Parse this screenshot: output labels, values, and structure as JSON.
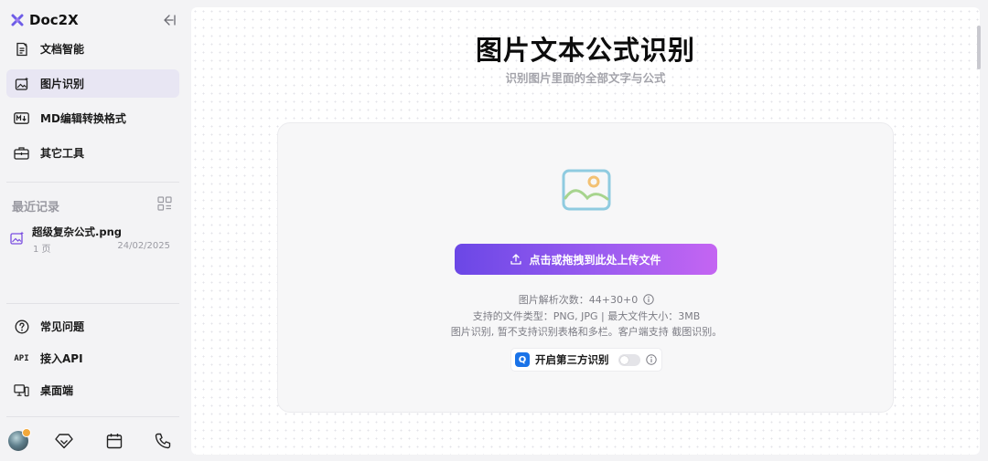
{
  "brand": {
    "name": "Doc2X"
  },
  "sidebar": {
    "nav": [
      {
        "label": "文档智能",
        "icon": "document-ai-icon",
        "active": false
      },
      {
        "label": "图片识别",
        "icon": "image-recognition-icon",
        "active": true
      },
      {
        "label": "MD编辑转换格式",
        "icon": "markdown-icon",
        "active": false
      },
      {
        "label": "其它工具",
        "icon": "toolbox-icon",
        "active": false
      }
    ],
    "recent": {
      "title": "最近记录",
      "items": [
        {
          "name": "超级复杂公式.png",
          "pages": "1 页",
          "date": "24/02/2025"
        }
      ]
    },
    "bottom_nav": [
      {
        "label": "常见问题",
        "icon": "help-icon"
      },
      {
        "label": "接入API",
        "icon": "api-icon",
        "glyph": "API"
      },
      {
        "label": "桌面端",
        "icon": "desktop-icon"
      }
    ]
  },
  "main": {
    "title": "图片文本公式识别",
    "subtitle": "识别图片里面的全部文字与公式",
    "upload_button": "点击或拖拽到此处上传文件",
    "parse_count_label": "图片解析次数：44+30+0",
    "file_types": "支持的文件类型：PNG, JPG  |  最大文件大小：3MB",
    "notice": "图片识别, 暂不支持识别表格和多栏。客户端支持 截图识别。",
    "third_party": {
      "logo": "Q",
      "label": "开启第三方识别",
      "enabled": false
    }
  },
  "colors": {
    "accent_start": "#6b47e6",
    "accent_end": "#c465f2",
    "active_nav_bg": "#e8e6f3"
  }
}
